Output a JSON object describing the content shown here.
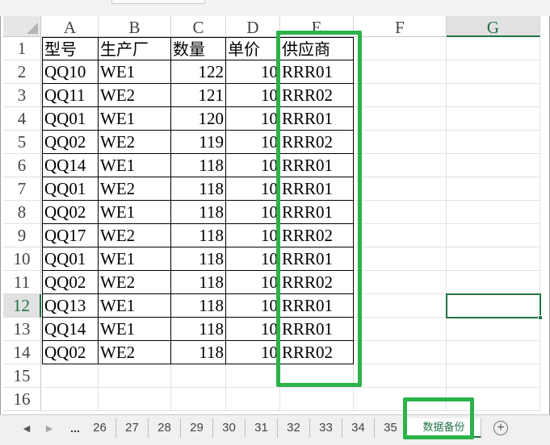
{
  "columns": [
    {
      "label": "A"
    },
    {
      "label": "B"
    },
    {
      "label": "C"
    },
    {
      "label": "D"
    },
    {
      "label": "E"
    },
    {
      "label": "F"
    },
    {
      "label": "G",
      "selected": true
    }
  ],
  "row_numbers": [
    "1",
    "2",
    "3",
    "4",
    "5",
    "6",
    "7",
    "8",
    "9",
    "10",
    "11",
    "12",
    "13",
    "14",
    "15",
    "16"
  ],
  "selected_row": "12",
  "table": {
    "header": [
      "型号",
      "生产厂",
      "数量",
      "单价",
      "供应商"
    ],
    "rows": [
      [
        "QQ10",
        "WE1",
        "122",
        "10",
        "RRR01"
      ],
      [
        "QQ11",
        "WE2",
        "121",
        "10",
        "RRR02"
      ],
      [
        "QQ01",
        "WE1",
        "120",
        "10",
        "RRR01"
      ],
      [
        "QQ02",
        "WE2",
        "119",
        "10",
        "RRR02"
      ],
      [
        "QQ14",
        "WE1",
        "118",
        "10",
        "RRR01"
      ],
      [
        "QQ01",
        "WE2",
        "118",
        "10",
        "RRR01"
      ],
      [
        "QQ02",
        "WE1",
        "118",
        "10",
        "RRR01"
      ],
      [
        "QQ17",
        "WE2",
        "118",
        "10",
        "RRR02"
      ],
      [
        "QQ01",
        "WE1",
        "118",
        "10",
        "RRR01"
      ],
      [
        "QQ02",
        "WE2",
        "118",
        "10",
        "RRR02"
      ],
      [
        "QQ13",
        "WE1",
        "118",
        "10",
        "RRR01"
      ],
      [
        "QQ14",
        "WE1",
        "118",
        "10",
        "RRR01"
      ],
      [
        "QQ02",
        "WE2",
        "118",
        "10",
        "RRR02"
      ]
    ]
  },
  "active_cell": "G12",
  "tabbar": {
    "nav_prev": "◀",
    "nav_next": "▶",
    "overflow": "...",
    "tabs": [
      "26",
      "27",
      "28",
      "29",
      "30",
      "31",
      "32",
      "33",
      "34",
      "35"
    ],
    "active_tab": "数据备份",
    "add_label": "+"
  },
  "colors": {
    "accent_green": "#217346",
    "highlight_green": "#2cb24a"
  },
  "icons": {
    "prev": "triangle-left-icon",
    "next": "triangle-right-icon",
    "add": "plus-circle-icon",
    "select_all": "corner-triangle-icon"
  }
}
